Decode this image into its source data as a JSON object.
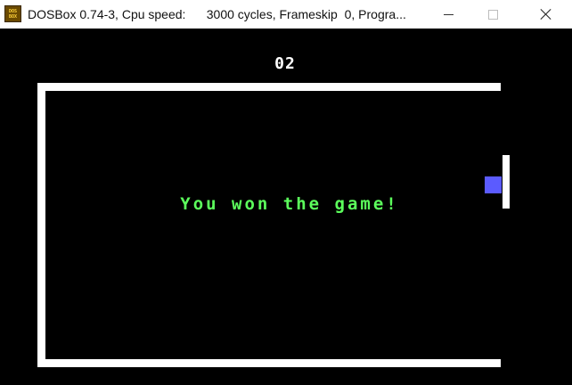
{
  "window": {
    "title": "DOSBox 0.74-3, Cpu speed:      3000 cycles, Frameskip  0, Progra...",
    "icon": "dosbox-icon",
    "icon_text_top": "DOS",
    "icon_text_bottom": "BOX"
  },
  "controls": {
    "minimize": "minimize-icon",
    "maximize": "maximize-icon",
    "close": "close-icon"
  },
  "game": {
    "score": "02",
    "message": "You won the game!",
    "colors": {
      "background": "#000000",
      "walls": "#ffffff",
      "paddle": "#ffffff",
      "ball": "#5b5bff",
      "message": "#5cff5c"
    }
  }
}
